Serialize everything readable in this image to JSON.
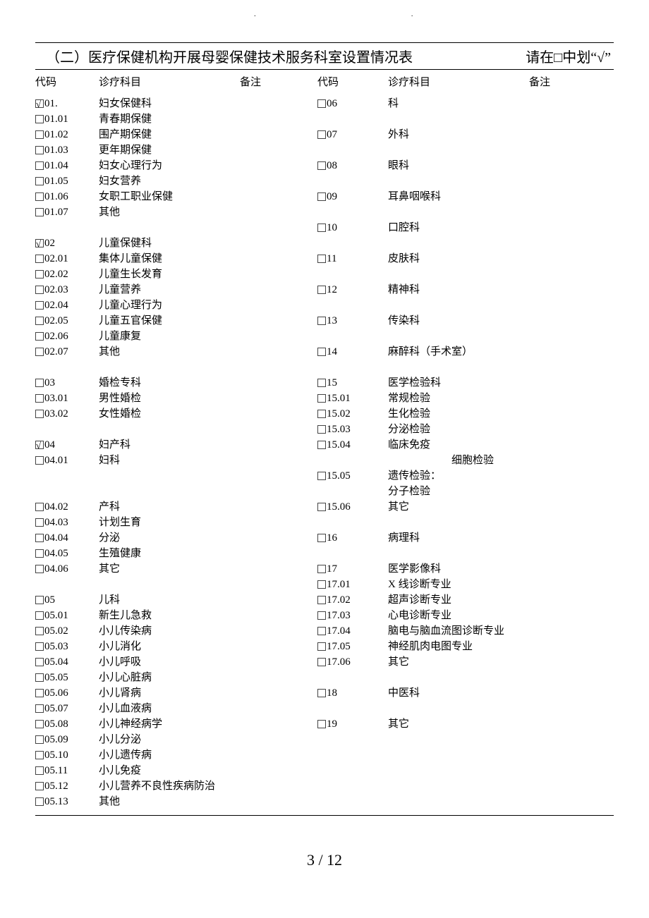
{
  "title": "（二）医疗保健机构开展母婴保健技术服务科室设置情况表",
  "title_hint": "请在□中划“√”",
  "headers": {
    "code": "代码",
    "subject": "诊疗科目",
    "note": "备注"
  },
  "left": [
    {
      "code": "01.",
      "checked": true,
      "subject": "妇女保健科"
    },
    {
      "code": "01.01",
      "checked": false,
      "subject": "青春期保健"
    },
    {
      "code": "01.02",
      "checked": false,
      "subject": "围产期保健"
    },
    {
      "code": "01.03",
      "checked": false,
      "subject": "更年期保健"
    },
    {
      "code": "01.04",
      "checked": false,
      "subject": "妇女心理行为"
    },
    {
      "code": "01.05",
      "checked": false,
      "subject": "妇女营养"
    },
    {
      "code": "01.06",
      "checked": false,
      "subject": "女职工职业保健"
    },
    {
      "code": "01.07",
      "checked": false,
      "subject": "其他"
    },
    {
      "spacer": true
    },
    {
      "code": "02",
      "checked": true,
      "subject": "儿童保健科"
    },
    {
      "code": "02.01",
      "checked": false,
      "subject": "集体儿童保健"
    },
    {
      "code": "02.02",
      "checked": false,
      "subject": "儿童生长发育"
    },
    {
      "code": "02.03",
      "checked": false,
      "subject": "儿童营养"
    },
    {
      "code": "02.04",
      "checked": false,
      "subject": "儿童心理行为"
    },
    {
      "code": "02.05",
      "checked": false,
      "subject": "儿童五官保健"
    },
    {
      "code": "02.06",
      "checked": false,
      "subject": "儿童康复"
    },
    {
      "code": "02.07",
      "checked": false,
      "subject": "其他"
    },
    {
      "spacer": true
    },
    {
      "code": "03",
      "checked": false,
      "subject": "婚检专科"
    },
    {
      "code": "03.01",
      "checked": false,
      "subject": "男性婚检"
    },
    {
      "code": "03.02",
      "checked": false,
      "subject": "女性婚检"
    },
    {
      "spacer": true
    },
    {
      "code": "04",
      "checked": true,
      "subject": "妇产科"
    },
    {
      "code": "04.01",
      "checked": false,
      "subject": "妇科"
    },
    {
      "spacer": true
    },
    {
      "spacer": true
    },
    {
      "code": "04.02",
      "checked": false,
      "subject": "产科"
    },
    {
      "code": "04.03",
      "checked": false,
      "subject": "计划生育"
    },
    {
      "code": "04.04",
      "checked": false,
      "subject": "分泌"
    },
    {
      "code": "04.05",
      "checked": false,
      "subject": "生殖健康"
    },
    {
      "code": "04.06",
      "checked": false,
      "subject": "其它"
    },
    {
      "spacer": true
    },
    {
      "code": "05",
      "checked": false,
      "subject": "儿科"
    },
    {
      "code": "05.01",
      "checked": false,
      "subject": "新生儿急救"
    },
    {
      "code": "05.02",
      "checked": false,
      "subject": "小儿传染病"
    },
    {
      "code": "05.03",
      "checked": false,
      "subject": "小儿消化"
    },
    {
      "code": "05.04",
      "checked": false,
      "subject": "小儿呼吸"
    },
    {
      "code": "05.05",
      "checked": false,
      "subject": "小儿心脏病"
    },
    {
      "code": "05.06",
      "checked": false,
      "subject": "小儿肾病"
    },
    {
      "code": "05.07",
      "checked": false,
      "subject": "小儿血液病"
    },
    {
      "code": "05.08",
      "checked": false,
      "subject": "小儿神经病学"
    },
    {
      "code": "05.09",
      "checked": false,
      "subject": "小儿分泌"
    },
    {
      "code": "05.10",
      "checked": false,
      "subject": "小儿遗传病"
    },
    {
      "code": "05.11",
      "checked": false,
      "subject": "小儿免疫"
    },
    {
      "code": "05.12",
      "checked": false,
      "subject": "小儿营养不良性疾病防治"
    },
    {
      "code": "05.13",
      "checked": false,
      "subject": "其他"
    }
  ],
  "right": [
    {
      "code": "06",
      "checked": false,
      "subject": "科"
    },
    {
      "spacer": true
    },
    {
      "code": "07",
      "checked": false,
      "subject": "外科"
    },
    {
      "spacer": true
    },
    {
      "code": "08",
      "checked": false,
      "subject": "眼科"
    },
    {
      "spacer": true
    },
    {
      "code": "09",
      "checked": false,
      "subject": "耳鼻咽喉科"
    },
    {
      "spacer": true
    },
    {
      "code": "10",
      "checked": false,
      "subject": "口腔科"
    },
    {
      "spacer": true
    },
    {
      "code": "11",
      "checked": false,
      "subject": "皮肤科"
    },
    {
      "spacer": true
    },
    {
      "code": "12",
      "checked": false,
      "subject": "精神科"
    },
    {
      "spacer": true
    },
    {
      "code": "13",
      "checked": false,
      "subject": "传染科"
    },
    {
      "spacer": true
    },
    {
      "code": "14",
      "checked": false,
      "subject": "麻醉科（手术室）"
    },
    {
      "spacer": true
    },
    {
      "code": "15",
      "checked": false,
      "subject": "医学检验科"
    },
    {
      "code": "15.01",
      "checked": false,
      "subject": "常规检验"
    },
    {
      "code": "15.02",
      "checked": false,
      "subject": "生化检验"
    },
    {
      "code": "15.03",
      "checked": false,
      "subject": "分泌检验"
    },
    {
      "code": "15.04",
      "checked": false,
      "subject": "临床免疫"
    },
    {
      "indent": true,
      "subject": "细胞检验"
    },
    {
      "code": "15.05",
      "checked": false,
      "subject": "遗传检验："
    },
    {
      "nocb": true,
      "subject": "分子检验"
    },
    {
      "code": "15.06",
      "checked": false,
      "subject": "其它"
    },
    {
      "spacer": true
    },
    {
      "code": "16",
      "checked": false,
      "subject": "病理科"
    },
    {
      "spacer": true
    },
    {
      "code": "17",
      "checked": false,
      "subject": "医学影像科"
    },
    {
      "code": "17.01",
      "checked": false,
      "subject": "X 线诊断专业"
    },
    {
      "code": "17.02",
      "checked": false,
      "subject": "超声诊断专业"
    },
    {
      "code": "17.03",
      "checked": false,
      "subject": "心电诊断专业"
    },
    {
      "code": "17.04",
      "checked": false,
      "subject": "脑电与脑血流图诊断专业"
    },
    {
      "code": "17.05",
      "checked": false,
      "subject": "神经肌肉电图专业"
    },
    {
      "code": "17.06",
      "checked": false,
      "subject": "其它"
    },
    {
      "spacer": true
    },
    {
      "code": "18",
      "checked": false,
      "subject": "中医科"
    },
    {
      "spacer": true
    },
    {
      "code": "19",
      "checked": false,
      "subject": "其它"
    }
  ],
  "pager": "3 / 12"
}
